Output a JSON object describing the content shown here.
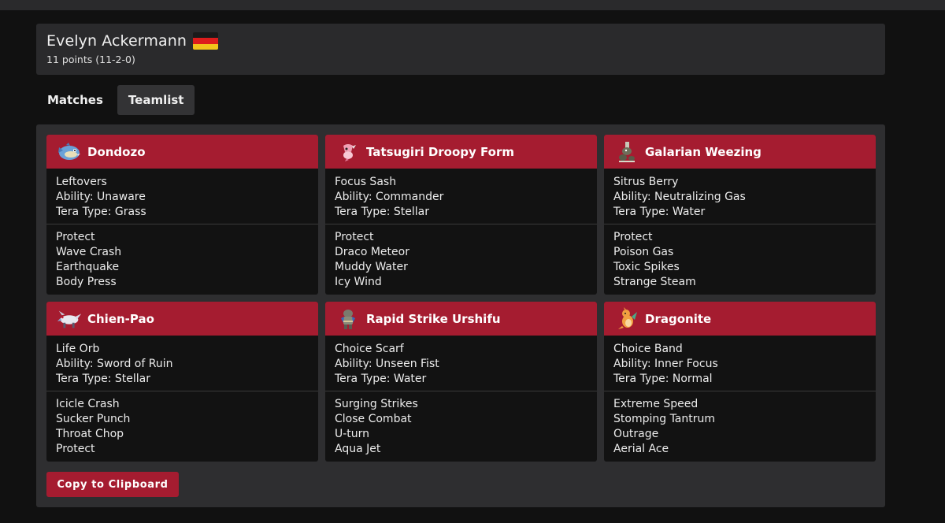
{
  "player": {
    "name": "Evelyn Ackermann",
    "flag_icon": "germany-flag-icon",
    "points": "11 points (11-2-0)"
  },
  "tabs": [
    {
      "label": "Matches",
      "active": false
    },
    {
      "label": "Teamlist",
      "active": true
    }
  ],
  "team": [
    {
      "name": "Dondozo",
      "sprite_icon": "dondozo-sprite-icon",
      "item": "Leftovers",
      "ability": "Ability: Unaware",
      "tera": "Tera Type: Grass",
      "moves": [
        "Protect",
        "Wave Crash",
        "Earthquake",
        "Body Press"
      ]
    },
    {
      "name": "Tatsugiri Droopy Form",
      "sprite_icon": "tatsugiri-sprite-icon",
      "item": "Focus Sash",
      "ability": "Ability: Commander",
      "tera": "Tera Type: Stellar",
      "moves": [
        "Protect",
        "Draco Meteor",
        "Muddy Water",
        "Icy Wind"
      ]
    },
    {
      "name": "Galarian Weezing",
      "sprite_icon": "galarian-weezing-sprite-icon",
      "item": "Sitrus Berry",
      "ability": "Ability: Neutralizing Gas",
      "tera": "Tera Type: Water",
      "moves": [
        "Protect",
        "Poison Gas",
        "Toxic Spikes",
        "Strange Steam"
      ]
    },
    {
      "name": "Chien-Pao",
      "sprite_icon": "chien-pao-sprite-icon",
      "item": "Life Orb",
      "ability": "Ability: Sword of Ruin",
      "tera": "Tera Type: Stellar",
      "moves": [
        "Icicle Crash",
        "Sucker Punch",
        "Throat Chop",
        "Protect"
      ]
    },
    {
      "name": "Rapid Strike Urshifu",
      "sprite_icon": "urshifu-sprite-icon",
      "item": "Choice Scarf",
      "ability": "Ability: Unseen Fist",
      "tera": "Tera Type: Water",
      "moves": [
        "Surging Strikes",
        "Close Combat",
        "U-turn",
        "Aqua Jet"
      ]
    },
    {
      "name": "Dragonite",
      "sprite_icon": "dragonite-sprite-icon",
      "item": "Choice Band",
      "ability": "Ability: Inner Focus",
      "tera": "Tera Type: Normal",
      "moves": [
        "Extreme Speed",
        "Stomping Tantrum",
        "Outrage",
        "Aerial Ace"
      ]
    }
  ],
  "copy_button": {
    "label": "Copy to Clipboard"
  },
  "colors": {
    "accent": "#a51c30",
    "panel": "#2e2e30",
    "card": "#121212"
  }
}
